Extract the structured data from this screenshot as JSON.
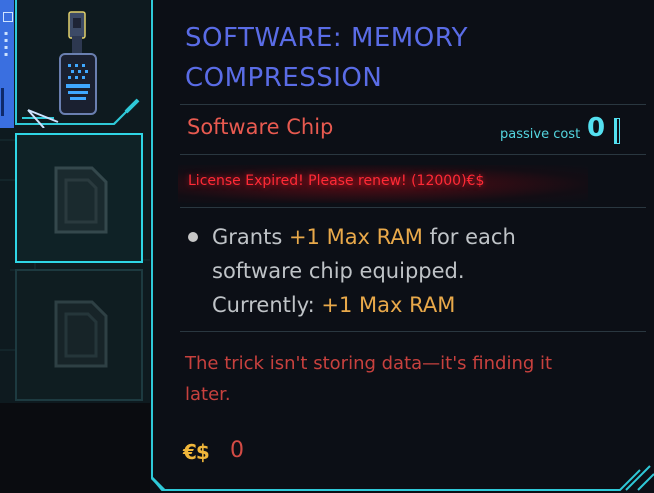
{
  "item": {
    "title_line1": "SOFTWARE: MEMORY",
    "title_line2": "COMPRESSION",
    "type": "Software Chip",
    "passive_cost_label": "passive cost",
    "passive_cost_value": "0",
    "license_warning": "License Expired! Please renew! (12000)€$",
    "description": {
      "prefix": "Grants ",
      "highlight1": "+1 Max RAM",
      "middle": " for each software chip equipped.",
      "current_label": "Currently: ",
      "current_value": "+1 Max RAM"
    },
    "flavor_text": "The trick isn't storing data—it's finding it later.",
    "price_icon": "€$",
    "price": "0"
  },
  "inventory": {
    "slots": [
      {
        "state": "filled",
        "icon": "memory-chip-icon"
      },
      {
        "state": "empty",
        "icon": "empty-chip-slot-icon",
        "selected": true
      },
      {
        "state": "empty",
        "icon": "empty-chip-slot-icon",
        "selected": false
      }
    ]
  },
  "colors": {
    "title": "#5a6ce6",
    "accent_cyan": "#54d6e0",
    "warning_red": "#ff2a36",
    "highlight_orange": "#e9a94a",
    "flavor_red": "#c8413e"
  }
}
